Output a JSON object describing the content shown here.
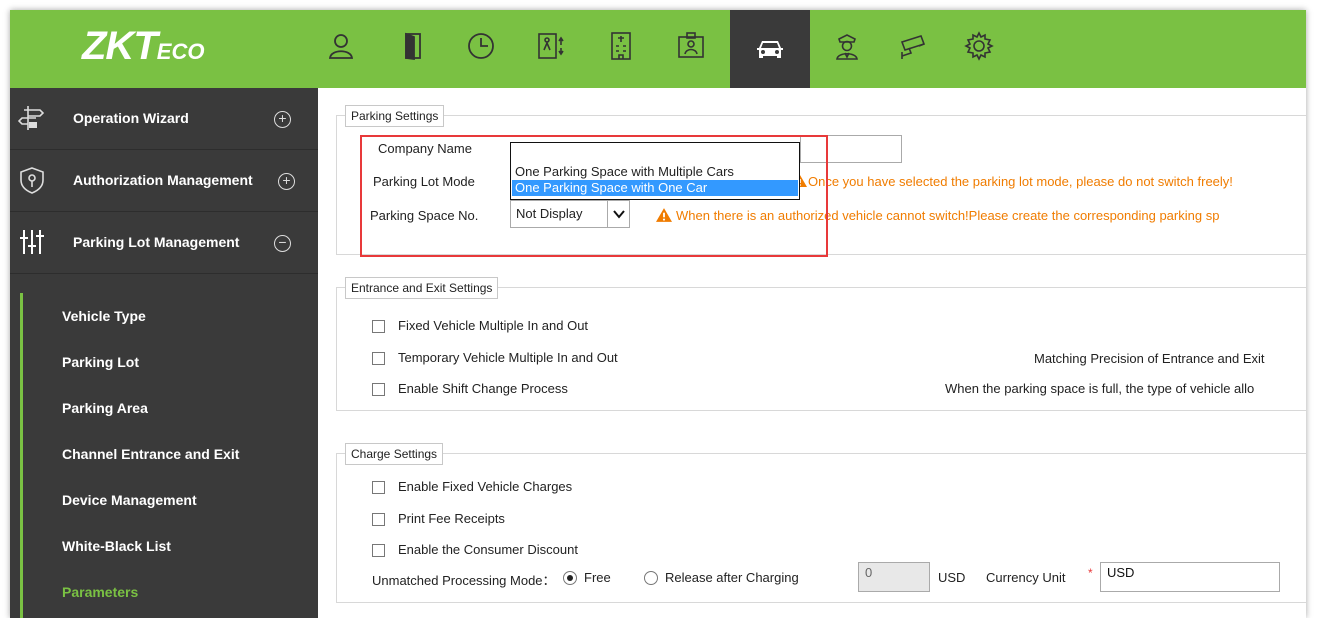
{
  "app": {
    "logo_main": "ZKT",
    "logo_small": "ECO"
  },
  "nav": {
    "icons": [
      "person-icon",
      "door-icon",
      "clock-icon",
      "elevator-icon",
      "building-icon",
      "visitor-card-icon",
      "car-icon",
      "guard-icon",
      "camera-icon",
      "gear-icon"
    ],
    "active": "car-icon"
  },
  "sidebar": {
    "sections": [
      {
        "label": "Operation Wizard",
        "toggle": "+"
      },
      {
        "label": "Authorization Management",
        "toggle": "+"
      },
      {
        "label": "Parking Lot Management",
        "toggle": "−"
      }
    ],
    "items": [
      {
        "label": "Vehicle Type"
      },
      {
        "label": "Parking Lot"
      },
      {
        "label": "Parking Area"
      },
      {
        "label": "Channel Entrance and Exit"
      },
      {
        "label": "Device Management"
      },
      {
        "label": "White-Black List"
      },
      {
        "label": "Parameters"
      }
    ],
    "active_item": "Parameters"
  },
  "parking_settings": {
    "legend": "Parking Settings",
    "company_name_label": "Company Name",
    "company_name_value": "",
    "parking_lot_mode_label": "Parking Lot Mode",
    "parking_lot_mode_options": [
      "One Parking Space with Multiple Cars",
      "One Parking Space with One Car"
    ],
    "parking_lot_mode_selected": "One Parking Space with One Car",
    "parking_lot_mode_warning": "Once you have selected the parking lot mode, please do not switch freely!",
    "parking_space_no_label": "Parking Space No.",
    "parking_space_no_value": "Not Display",
    "parking_space_warning": "When there is an authorized vehicle cannot switch!Please create the corresponding parking sp"
  },
  "entrance_exit": {
    "legend": "Entrance and Exit Settings",
    "options": [
      {
        "label": "Fixed Vehicle Multiple In and Out",
        "checked": false
      },
      {
        "label": "Temporary Vehicle Multiple In and Out",
        "checked": false
      },
      {
        "label": "Enable Shift Change Process",
        "checked": false
      }
    ],
    "matching_precision_label": "Matching Precision of Entrance and Exit",
    "full_space_label": "When the parking space is full, the type of vehicle allo"
  },
  "charge": {
    "legend": "Charge Settings",
    "options": [
      {
        "label": "Enable Fixed Vehicle Charges",
        "checked": false
      },
      {
        "label": "Print Fee Receipts",
        "checked": false
      },
      {
        "label": "Enable the Consumer Discount",
        "checked": false
      }
    ],
    "unmatched_label": "Unmatched Processing Mode：",
    "free_label": "Free",
    "release_label": "Release after Charging",
    "selected_mode": "Free",
    "fee_value": "0",
    "fee_unit": "USD",
    "currency_label": "Currency Unit",
    "required_mark": "*",
    "currency_value": "USD"
  },
  "colors": {
    "brand_green": "#7ac143",
    "sidebar_bg": "#3a3a3a",
    "warning": "#f07c00",
    "highlight_box": "#e8393a",
    "selection": "#3399ff"
  }
}
